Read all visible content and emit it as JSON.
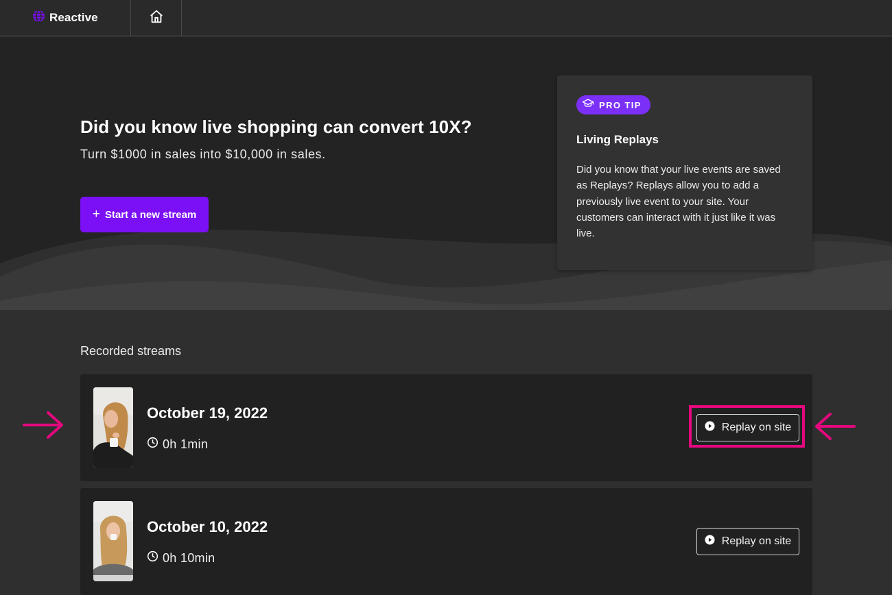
{
  "app": {
    "brand_name": "Reactive"
  },
  "nav": {
    "home_icon": "home-icon"
  },
  "hero": {
    "title": "Did you know live shopping can convert 10X?",
    "subtitle": "Turn $1000 in sales into $10,000 in sales.",
    "start_button": {
      "icon": "+",
      "label": "Start a new stream"
    }
  },
  "tip": {
    "badge": "PRO TIP",
    "badge_icon": "graduation-cap-icon",
    "title": "Living Replays",
    "body": "Did you know that your live events are saved as Replays? Replays allow you to add a previously live event to your site. Your customers can interact with it just like it was live."
  },
  "recorded": {
    "title": "Recorded streams",
    "streams": [
      {
        "date": "October 19, 2022",
        "duration": "0h 1min",
        "button": "Replay on site",
        "highlighted": true
      },
      {
        "date": "October 10, 2022",
        "duration": "0h 10min",
        "button": "Replay on site",
        "highlighted": false
      }
    ]
  },
  "colors": {
    "accent": "#7b0ff5",
    "badge": "#7b2ff7",
    "annotation": "#e4087e",
    "background": "#2f2f2f",
    "hero_background": "#232323",
    "card": "#212121"
  }
}
